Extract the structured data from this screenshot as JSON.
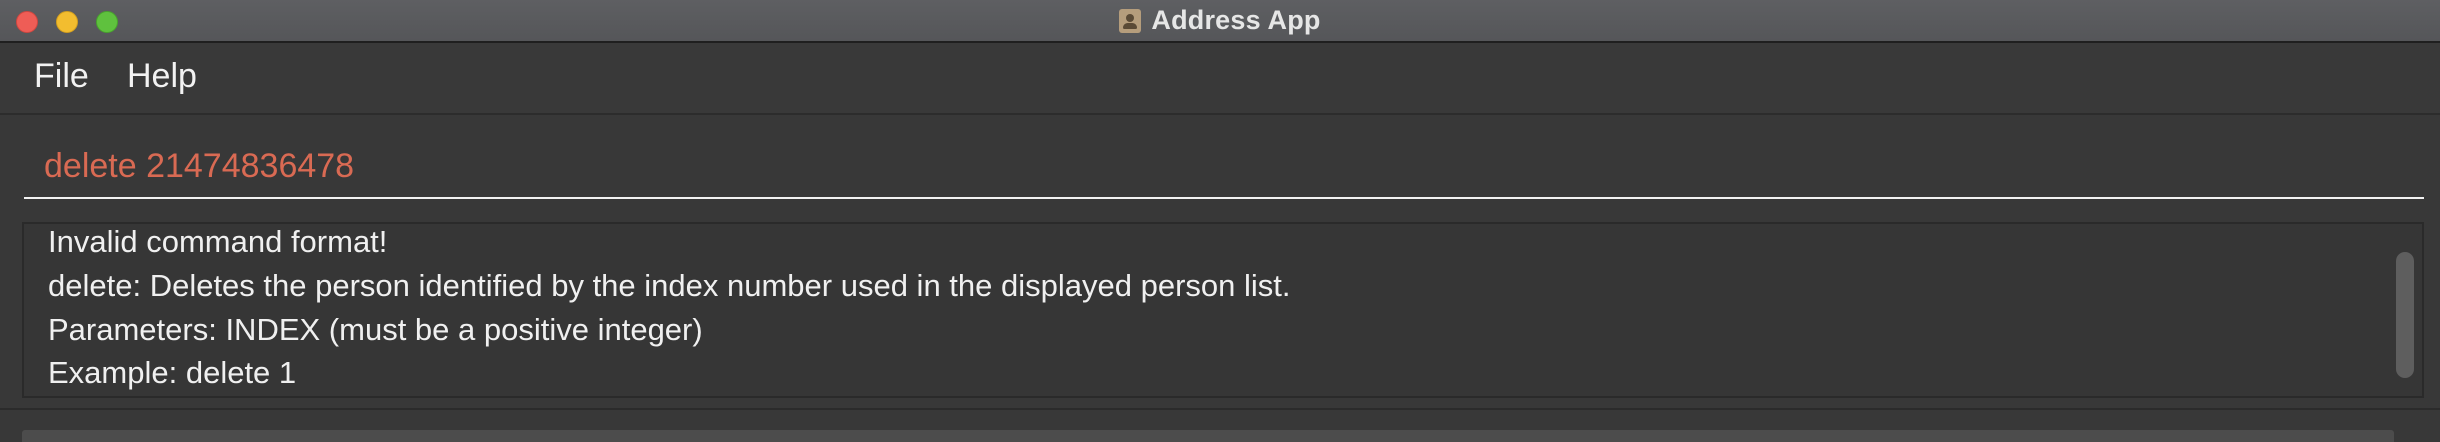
{
  "window": {
    "title": "Address App",
    "app_icon": "address-book-icon"
  },
  "menu": {
    "items": [
      {
        "label": "File"
      },
      {
        "label": "Help"
      }
    ]
  },
  "command": {
    "value": "delete 21474836478",
    "error_color": "#d96a53"
  },
  "result": {
    "lines": [
      "Invalid command format!",
      "delete: Deletes the person identified by the index number used in the displayed person list.",
      "Parameters: INDEX (must be a positive integer)",
      "Example: delete 1"
    ]
  }
}
